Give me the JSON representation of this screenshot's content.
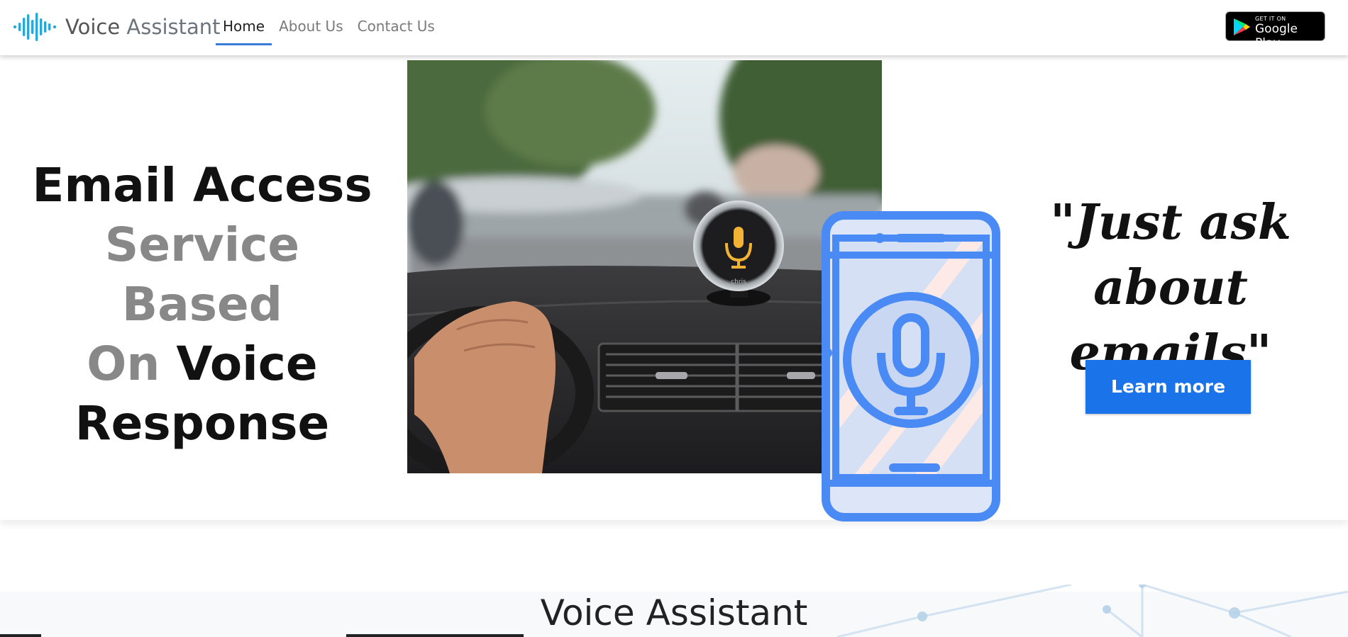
{
  "navbar": {
    "brand": {
      "word1": "Voice",
      "word2": " Assistant",
      "logo_icon": "soundwave-icon"
    },
    "items": [
      {
        "label": "Home",
        "active": true
      },
      {
        "label": "About Us",
        "active": false
      },
      {
        "label": "Contact Us",
        "active": false
      }
    ],
    "store_badge": {
      "small": "GET IT ON",
      "big": "Google Play",
      "icon": "google-play-icon"
    }
  },
  "hero": {
    "title_line1": "Email Access",
    "title_line2": "Service Based",
    "title_line3_grey": "On",
    "title_line3_black": " Voice",
    "title_line4": "Response",
    "photo_alt": "driver with voice assistant device on dashboard",
    "device_label": "chris",
    "phone_icon": "phone-microphone-icon",
    "quote_line1": "\"Just ask",
    "quote_line2": "about emails\"",
    "cta_label": "Learn more"
  },
  "section": {
    "title": "Voice Assistant"
  },
  "colors": {
    "accent": "#1a73e8",
    "nav_active_underline": "#3a7bd5",
    "brand_logo": "#2aa7d9",
    "phone_icon": "#4a8af4"
  }
}
